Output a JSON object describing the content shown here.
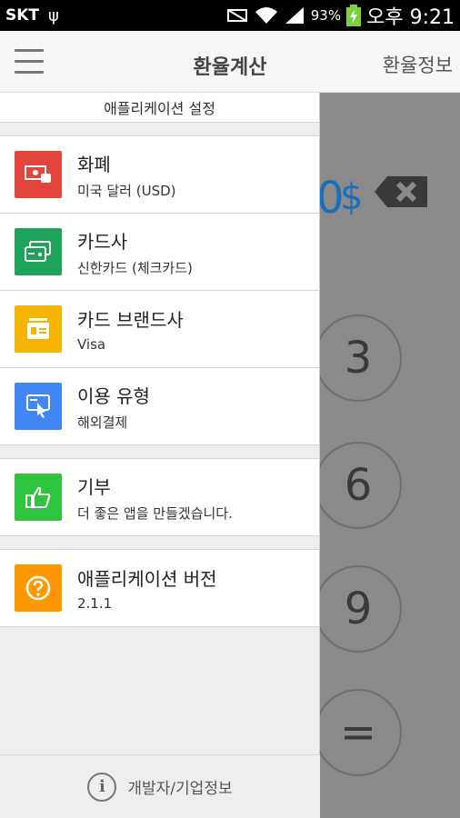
{
  "status_bar": {
    "carrier": "SKT",
    "usb": "ψ",
    "battery_pct": "93%",
    "time": "오후 9:21"
  },
  "app_bar": {
    "title": "환율계산",
    "action": "환율정보"
  },
  "drawer": {
    "header": "애플리케이션 설정",
    "items": [
      {
        "title": "화폐",
        "subtitle": "미국 달러 (USD)",
        "icon": "currency-icon",
        "color": "#e2453c"
      },
      {
        "title": "카드사",
        "subtitle": "신한카드 (체크카드)",
        "icon": "card-company-icon",
        "color": "#1ea35b"
      },
      {
        "title": "카드 브랜드사",
        "subtitle": "Visa",
        "icon": "card-brand-icon",
        "color": "#f4b400"
      },
      {
        "title": "이용 유형",
        "subtitle": "해외결제",
        "icon": "usage-type-icon",
        "color": "#4285f4"
      },
      {
        "title": "기부",
        "subtitle": "더 좋은 앱을 만들겠습니다.",
        "icon": "thumbs-up-icon",
        "color": "#2ec440"
      },
      {
        "title": "애플리케이션 버전",
        "subtitle": "2.1.1",
        "icon": "question-icon",
        "color": "#ff9800"
      }
    ],
    "footer": "개발자/기업정보"
  },
  "calculator": {
    "amount_tail": "0",
    "currency_symbol": "$",
    "keys": [
      "3",
      "6",
      "9",
      "="
    ]
  }
}
